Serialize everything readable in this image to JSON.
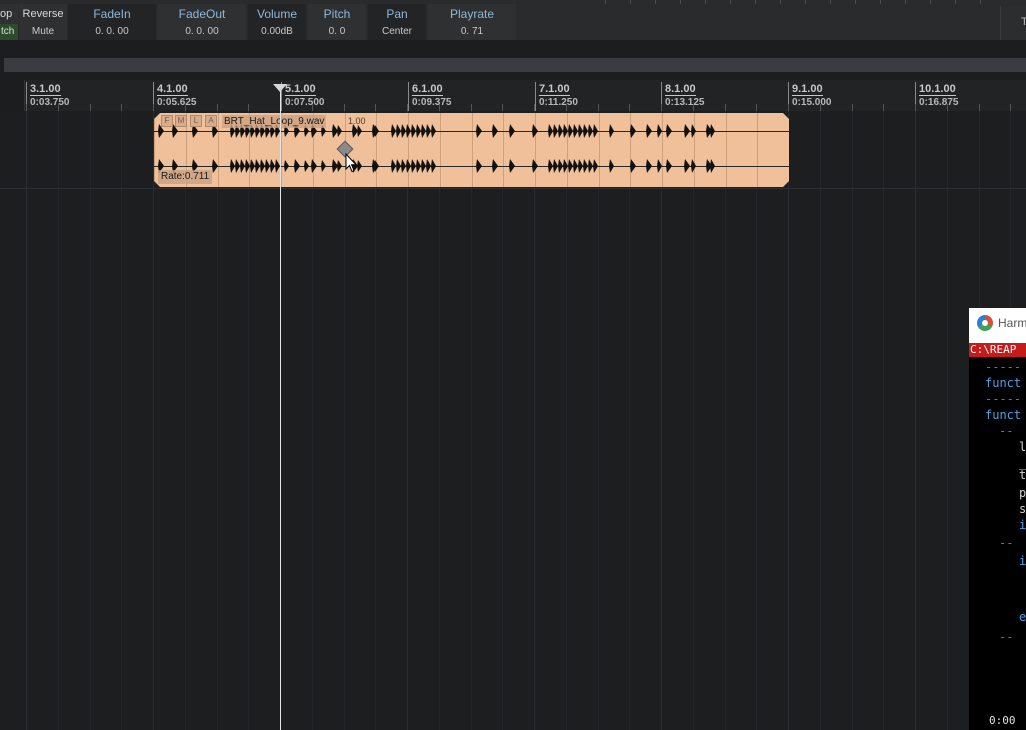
{
  "props": {
    "col_loop_hdr": "op",
    "col_loop_val": "tch",
    "reverse_hdr": "Reverse",
    "reverse_val": "Mute",
    "fadein_hdr": "FadeIn",
    "fadein_val": "0. 0. 00",
    "fadeout_hdr": "FadeOut",
    "fadeout_val": "0. 0. 00",
    "volume_hdr": "Volume",
    "volume_val": "0.00dB",
    "pitch_hdr": "Pitch",
    "pitch_val": "0. 0",
    "pan_hdr": "Pan",
    "pan_val": "Center",
    "playrate_hdr": "Playrate",
    "playrate_val": "0. 71",
    "right_panel_text": "T"
  },
  "ruler": {
    "bars": [
      {
        "measure": "3.1.00",
        "time": "0:03.750"
      },
      {
        "measure": "4.1.00",
        "time": "0:05.625"
      },
      {
        "measure": "5.1.00",
        "time": "0:07.500"
      },
      {
        "measure": "6.1.00",
        "time": "0:09.375"
      },
      {
        "measure": "7.1.00",
        "time": "0:11.250"
      },
      {
        "measure": "8.1.00",
        "time": "0:13.125"
      },
      {
        "measure": "9.1.00",
        "time": "0:15.000"
      },
      {
        "measure": "10.1.00",
        "time": "0:16.875"
      }
    ]
  },
  "item": {
    "name": "BRT_Hat_Loop_9.wav",
    "volume_label": "1.00",
    "rate_label": "Rate:0.711",
    "button_labels": [
      "F",
      "M",
      "L",
      "A"
    ]
  },
  "colors": {
    "item_fill": "#f0c09a",
    "playhead": "#e6e6e6",
    "code_path_bg": "#c41b1b",
    "keyword": "#4aa3e8"
  },
  "code_window": {
    "title": "Harm",
    "path": "C:\\REAP",
    "lines": [
      {
        "text": "-----",
        "cls": "dim"
      },
      {
        "text": "funct",
        "cls": "kw"
      },
      {
        "text": "-----",
        "cls": "dim"
      },
      {
        "text": "funct",
        "cls": "kw"
      },
      {
        "text": "--",
        "cls": "dim"
      },
      {
        "text": "l",
        "cls": "txt"
      },
      {
        "text": "_",
        "cls": "txt"
      },
      {
        "text": "t",
        "cls": "txt"
      },
      {
        "text": "p",
        "cls": "txt"
      },
      {
        "text": "s",
        "cls": "txt"
      },
      {
        "text": "i",
        "cls": "kw"
      },
      {
        "text": "--",
        "cls": "dim"
      },
      {
        "text": "i",
        "cls": "kw"
      },
      {
        "text": "e",
        "cls": "kw"
      },
      {
        "text": "--",
        "cls": "dim"
      }
    ],
    "time": "0:00"
  },
  "icons": {
    "playhead_marker": "triangle-down-icon",
    "mouse_cursor": "arrow-cursor-icon",
    "app_logo": "reaper-logo-icon"
  }
}
